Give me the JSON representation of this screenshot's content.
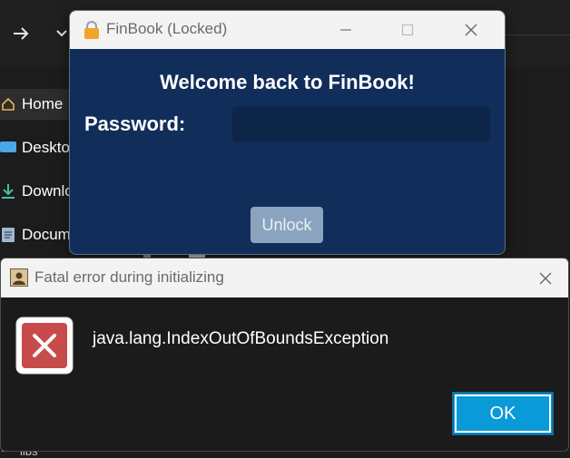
{
  "explorer": {
    "sidebar": [
      {
        "label": "Home",
        "icon": "home-icon"
      },
      {
        "label": "Deskto",
        "icon": "desktop-icon"
      },
      {
        "label": "Downlo",
        "icon": "download-icon"
      },
      {
        "label": "Docum",
        "icon": "document-icon"
      }
    ],
    "libs_label": "libs",
    "colors": {
      "background": "#1c1c1c",
      "hover": "#2d2d2d"
    }
  },
  "finbook": {
    "title": "FinBook (Locked)",
    "welcome": "Welcome back to FinBook!",
    "password_label": "Password:",
    "password_value": "",
    "unlock_label": "Unlock",
    "colors": {
      "background": "#112d5a",
      "input": "#0d2547",
      "button": "#8aa4bf"
    }
  },
  "error_dialog": {
    "title": "Fatal error during initializing",
    "message": "java.lang.IndexOutOfBoundsException",
    "ok_label": "OK",
    "colors": {
      "ok_button": "#0a9ad8",
      "error_icon": "#c84b4b"
    }
  }
}
